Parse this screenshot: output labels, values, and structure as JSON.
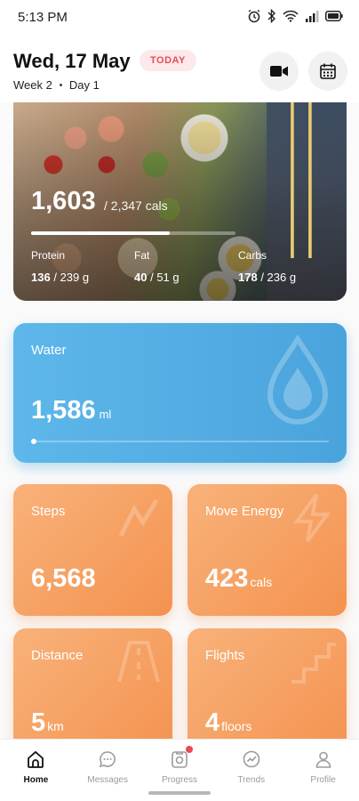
{
  "status_bar": {
    "time": "5:13 PM"
  },
  "header": {
    "date": "Wed, 17 May",
    "badge": "TODAY",
    "week": "Week 2",
    "day": "Day 1",
    "icons": [
      "video-camera-icon",
      "calendar-icon"
    ]
  },
  "nutrition": {
    "calories_consumed": "1,603",
    "calories_goal": "/ 2,347 cals",
    "calories_progress": 0.68,
    "macros": [
      {
        "label": "Protein",
        "value": "136",
        "goal": "/ 239 g"
      },
      {
        "label": "Fat",
        "value": "40",
        "goal": "/ 51 g"
      },
      {
        "label": "Carbs",
        "value": "178",
        "goal": "/ 236 g"
      }
    ]
  },
  "water": {
    "title": "Water",
    "value": "1,586",
    "unit": "ml",
    "progress": 0.0
  },
  "stats": [
    {
      "title": "Steps",
      "value": "6,568",
      "unit": ""
    },
    {
      "title": "Move Energy",
      "value": "423",
      "unit": "cals"
    },
    {
      "title": "Distance",
      "value": "5",
      "unit": "km"
    },
    {
      "title": "Flights",
      "value": "4",
      "unit": "floors"
    }
  ],
  "nav": [
    {
      "label": "Home",
      "icon": "home-icon",
      "active": true
    },
    {
      "label": "Messages",
      "icon": "messages-icon",
      "active": false
    },
    {
      "label": "Progress",
      "icon": "progress-icon",
      "active": false,
      "notification": true
    },
    {
      "label": "Trends",
      "icon": "trends-icon",
      "active": false
    },
    {
      "label": "Profile",
      "icon": "profile-icon",
      "active": false
    }
  ],
  "colors": {
    "water": "#4aa4dc",
    "orange": "#f4924f",
    "badge": "#e84b55"
  }
}
